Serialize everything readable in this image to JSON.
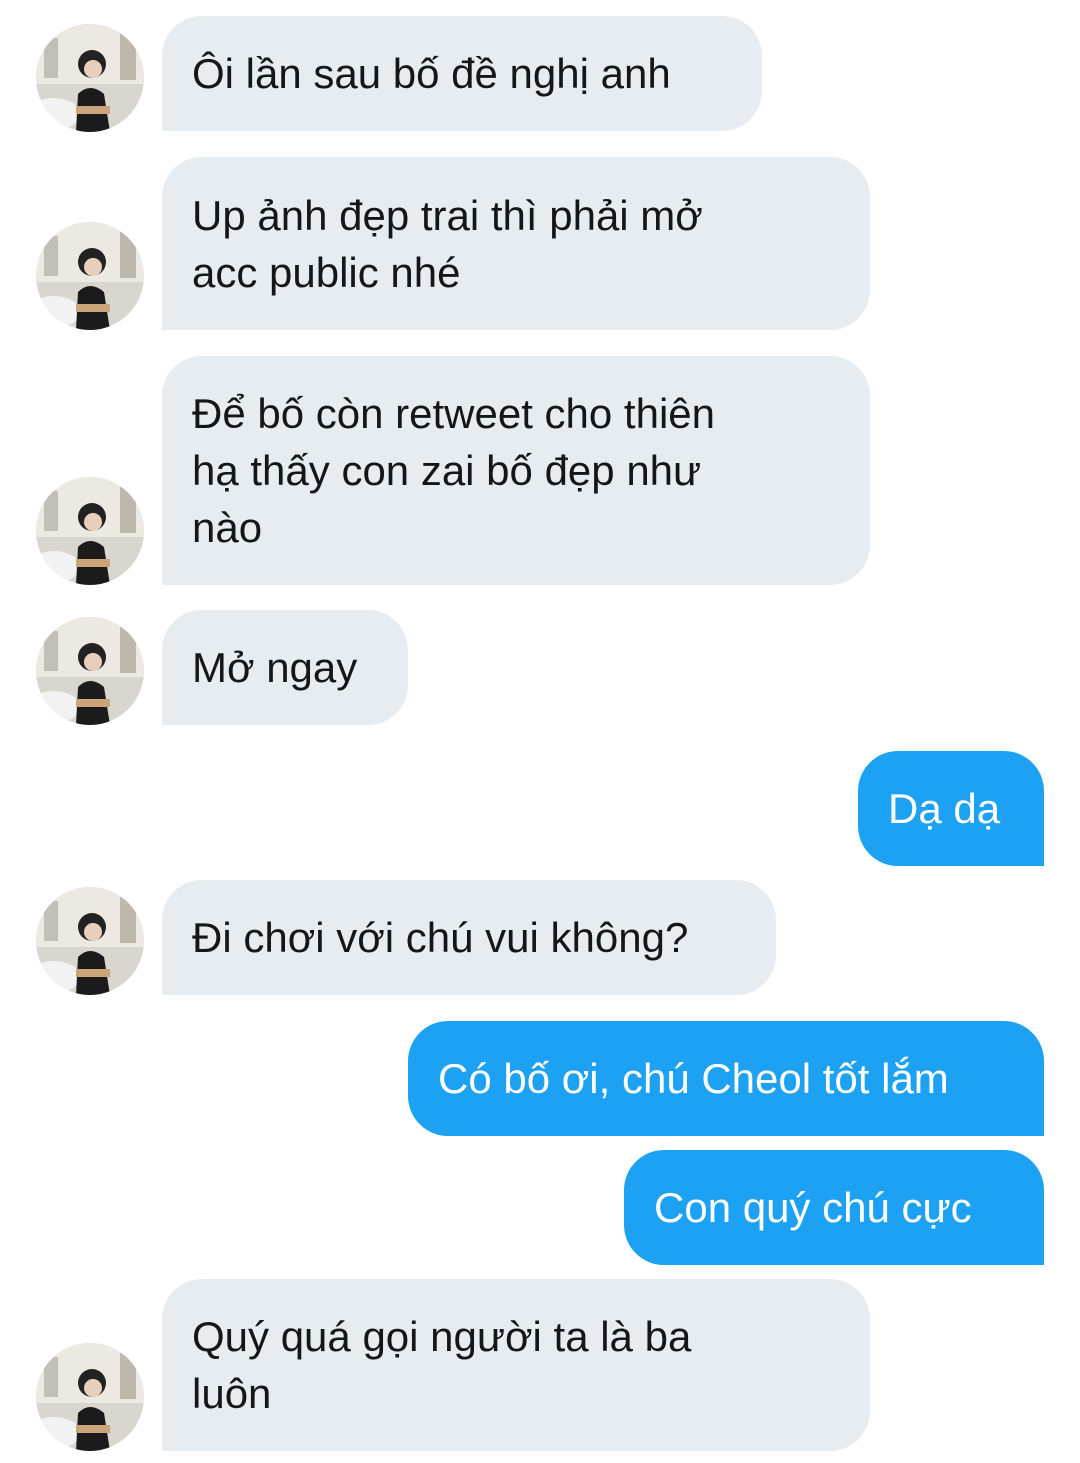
{
  "conversation": {
    "messages": [
      {
        "direction": "incoming",
        "text": "Ôi lần sau bố đề nghị anh"
      },
      {
        "direction": "incoming",
        "text": "Up ảnh đẹp trai thì phải mở\nacc public nhé"
      },
      {
        "direction": "incoming",
        "text": "Để bố còn retweet cho thiên\nhạ thấy con zai bố đẹp như\nnào"
      },
      {
        "direction": "incoming",
        "text": "Mở ngay"
      },
      {
        "direction": "outgoing",
        "text": "Dạ dạ"
      },
      {
        "direction": "incoming",
        "text": "Đi chơi với chú vui không?"
      },
      {
        "direction": "outgoing",
        "text": "Có bố ơi, chú Cheol tốt lắm"
      },
      {
        "direction": "outgoing",
        "text": "Con quý chú cực"
      },
      {
        "direction": "incoming",
        "text": "Quý quá gọi người ta là ba\nluôn"
      }
    ]
  },
  "colors": {
    "incoming_bubble": "#e6ecf0",
    "outgoing_bubble": "#1da1f2",
    "incoming_text": "#14171a",
    "outgoing_text": "#ffffff"
  },
  "icons": {
    "avatar": "user-avatar-photo"
  }
}
